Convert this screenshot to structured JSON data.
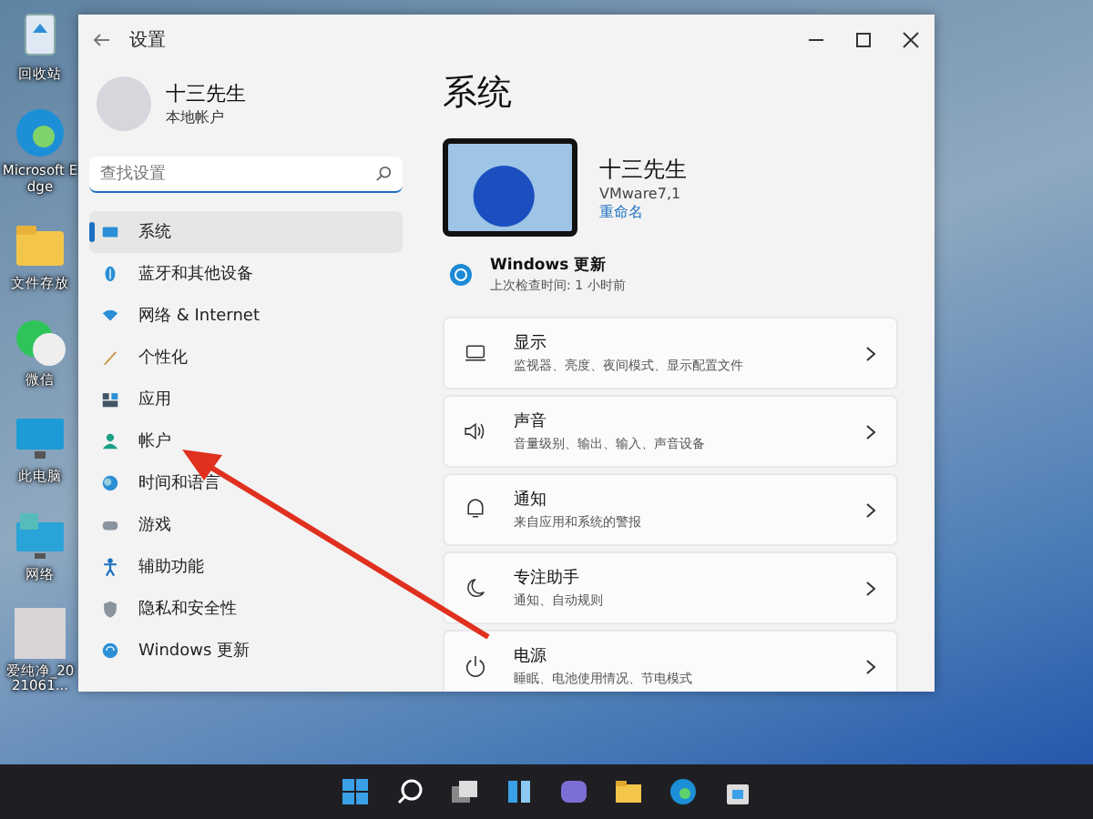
{
  "desktop_icons": [
    {
      "label": "回收站"
    },
    {
      "label": "Microsoft Edge"
    },
    {
      "label": "文件存放"
    },
    {
      "label": "微信"
    },
    {
      "label": "此电脑"
    },
    {
      "label": "网络"
    },
    {
      "label": "爱纯净_2021061..."
    }
  ],
  "window": {
    "title": "设置"
  },
  "profile": {
    "name": "十三先生",
    "account_type": "本地帐户"
  },
  "search": {
    "placeholder": "查找设置"
  },
  "nav_items": [
    {
      "label": "系统",
      "selected": true
    },
    {
      "label": "蓝牙和其他设备",
      "selected": false
    },
    {
      "label": "网络 & Internet",
      "selected": false
    },
    {
      "label": "个性化",
      "selected": false
    },
    {
      "label": "应用",
      "selected": false
    },
    {
      "label": "帐户",
      "selected": false
    },
    {
      "label": "时间和语言",
      "selected": false
    },
    {
      "label": "游戏",
      "selected": false
    },
    {
      "label": "辅助功能",
      "selected": false
    },
    {
      "label": "隐私和安全性",
      "selected": false
    },
    {
      "label": "Windows 更新",
      "selected": false
    }
  ],
  "page_title": "系统",
  "device": {
    "name": "十三先生",
    "model": "VMware7,1",
    "rename_link": "重命名"
  },
  "update": {
    "title": "Windows 更新",
    "subtitle": "上次检查时间: 1 小时前"
  },
  "cards": [
    {
      "title": "显示",
      "subtitle": "监视器、亮度、夜间模式、显示配置文件"
    },
    {
      "title": "声音",
      "subtitle": "音量级别、输出、输入、声音设备"
    },
    {
      "title": "通知",
      "subtitle": "来自应用和系统的警报"
    },
    {
      "title": "专注助手",
      "subtitle": "通知、自动规则"
    },
    {
      "title": "电源",
      "subtitle": "睡眠、电池使用情况、节电模式"
    }
  ]
}
